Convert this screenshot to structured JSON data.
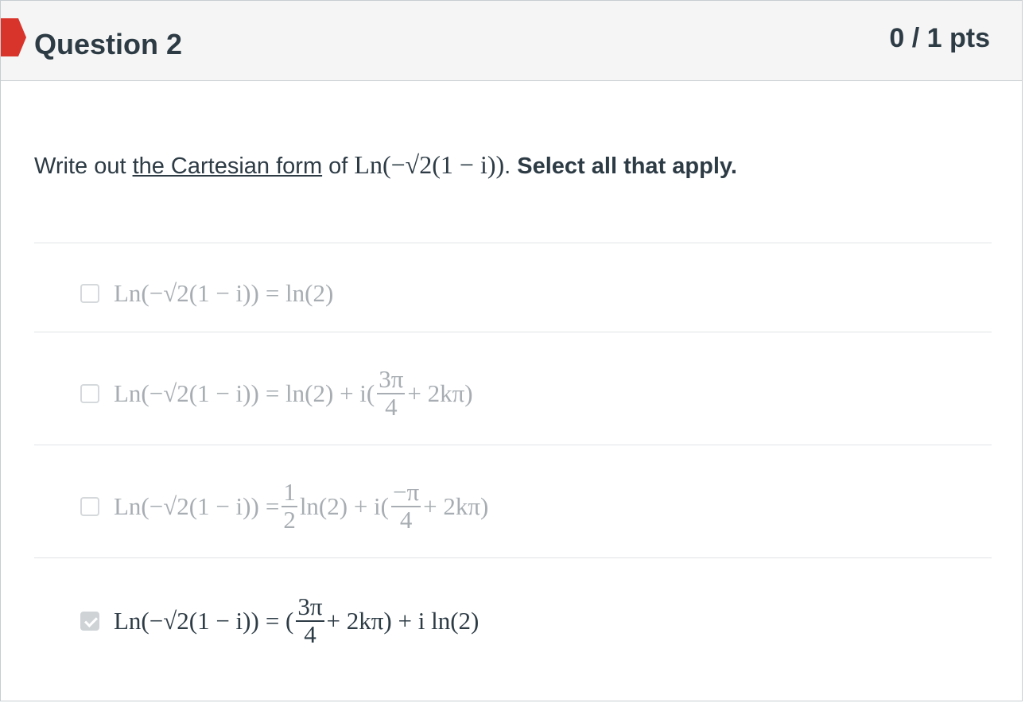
{
  "header": {
    "title": "Question 2",
    "points": "0 / 1 pts"
  },
  "prompt": {
    "lead": "Write out ",
    "link": "the Cartesian form",
    "mid": " of ",
    "expr": "Ln(−√2(1 − i))",
    "tail": ". ",
    "instruction": "Select all that apply."
  },
  "options": [
    {
      "lhs": "Ln(−√2(1 − i))",
      "rhs": "= ln(2)",
      "checked": false
    },
    {
      "lhs": "Ln(−√2(1 − i))",
      "rhs_a": "= ln(2) + i(",
      "num": "3π",
      "den": "4",
      "rhs_b": "+ 2kπ)",
      "checked": false
    },
    {
      "lhs": "Ln(−√2(1 − i))",
      "rhs_a": "=",
      "num1": "1",
      "den1": "2",
      "rhs_b": "ln(2) + i(",
      "num2": "−π",
      "den2": "4",
      "rhs_c": "+ 2kπ)",
      "checked": false
    },
    {
      "lhs": "Ln(−√2(1 − i))",
      "rhs_a": "= (",
      "num": "3π",
      "den": "4",
      "rhs_b": "+ 2kπ) + i ln(2)",
      "checked": true
    }
  ],
  "colors": {
    "flag": "#d9342b",
    "text": "#2d3b45",
    "muted": "#a7adb2"
  }
}
